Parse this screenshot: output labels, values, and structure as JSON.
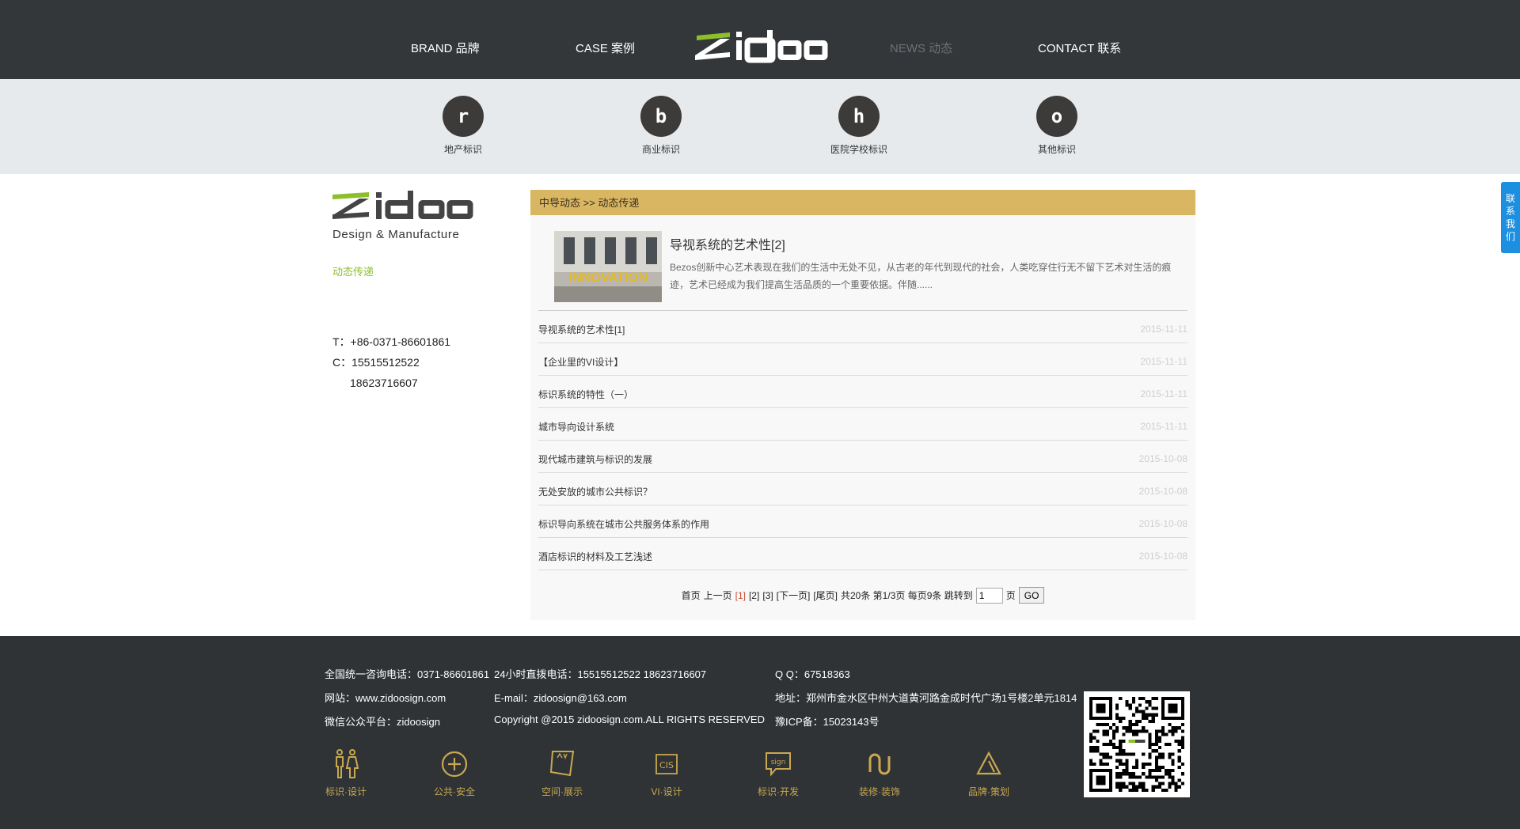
{
  "nav": {
    "brand": "BRAND 品牌",
    "case": "CASE 案例",
    "news": "NEWS 动态",
    "contact": "CONTACT 联系",
    "logo_text": "zidoo"
  },
  "categories": [
    {
      "glyph": "r",
      "label": "地产标识"
    },
    {
      "glyph": "b",
      "label": "商业标识"
    },
    {
      "glyph": "h",
      "label": "医院学校标识"
    },
    {
      "glyph": "o",
      "label": "其他标识"
    }
  ],
  "sidebar": {
    "tagline": "Design & Manufacture",
    "link": "动态传递",
    "tel": "T：+86-0371-86601861",
    "mobile1": "C：15515512522",
    "mobile2": "18623716607"
  },
  "content": {
    "breadcrumb": "中导动态 >> 动态传递",
    "featured": {
      "title": "导视系统的艺术性[2]",
      "description": "Bezos创新中心艺术表现在我们的生活中无处不见，从古老的年代到现代的社会，人类吃穿住行无不留下艺术对生活的痕迹，艺术已经成为我们提高生活品质的一个重要依据。伴随......",
      "image_text": "INNOVATION"
    },
    "news": [
      {
        "title": "导视系统的艺术性[1]",
        "date": "2015-11-11"
      },
      {
        "title": "【企业里的VI设计】",
        "date": "2015-11-11"
      },
      {
        "title": "标识系统的特性（一）",
        "date": "2015-11-11"
      },
      {
        "title": "城市导向设计系统",
        "date": "2015-11-11"
      },
      {
        "title": "现代城市建筑与标识的发展",
        "date": "2015-10-08"
      },
      {
        "title": "无处安放的城市公共标识？",
        "date": "2015-10-08"
      },
      {
        "title": "标识导向系统在城市公共服务体系的作用",
        "date": "2015-10-08"
      },
      {
        "title": "酒店标识的材料及工艺浅述",
        "date": "2015-10-08"
      }
    ],
    "pager": {
      "first": "首页",
      "prev": "上一页",
      "p1": "[1]",
      "p2": "[2]",
      "p3": "[3]",
      "next": "[下一页]",
      "last": "[尾页]",
      "summary": "共20条 第1/3页 每页9条 跳转到",
      "input_value": "1",
      "unit": "页",
      "go": "GO"
    }
  },
  "float_tab": "联系我们",
  "footer": {
    "hotline": "全国统一咨询电话：0371-86601861",
    "hotline24": "24小时直拨电话：15515512522 18623716607",
    "qq": "Q Q：67518363",
    "website": "网站：www.zidoosign.com",
    "email": "E-mail：zidoosign@163.com",
    "address": "地址：郑州市金水区中州大道黄河路金成时代广场1号楼2单元1814",
    "wechat": "微信公众平台：zidoosign",
    "copyright": "Copyright @2015 zidoosign.com.ALL RIGHTS RESERVED",
    "icp": "豫ICP备：15023143号",
    "icons": [
      {
        "name": "restroom-sign-icon",
        "label": "标识·设计"
      },
      {
        "name": "plus-circle-icon",
        "label": "公共·安全"
      },
      {
        "name": "display-frame-icon",
        "label": "空间·展示"
      },
      {
        "name": "cis-tag-icon",
        "label": "VI·设计"
      },
      {
        "name": "sign-bubble-icon",
        "label": "标识·开发"
      },
      {
        "name": "decoration-icon",
        "label": "装修·装饰"
      },
      {
        "name": "triangle-icon",
        "label": "品牌·策划"
      }
    ],
    "accent_color": "#c9a84f"
  },
  "colors": {
    "nav_bg": "#33373a",
    "breadcrumb_bg": "#d9b661",
    "link_green": "#8dbf2b",
    "float_tab_bg": "#1c8fe0"
  }
}
